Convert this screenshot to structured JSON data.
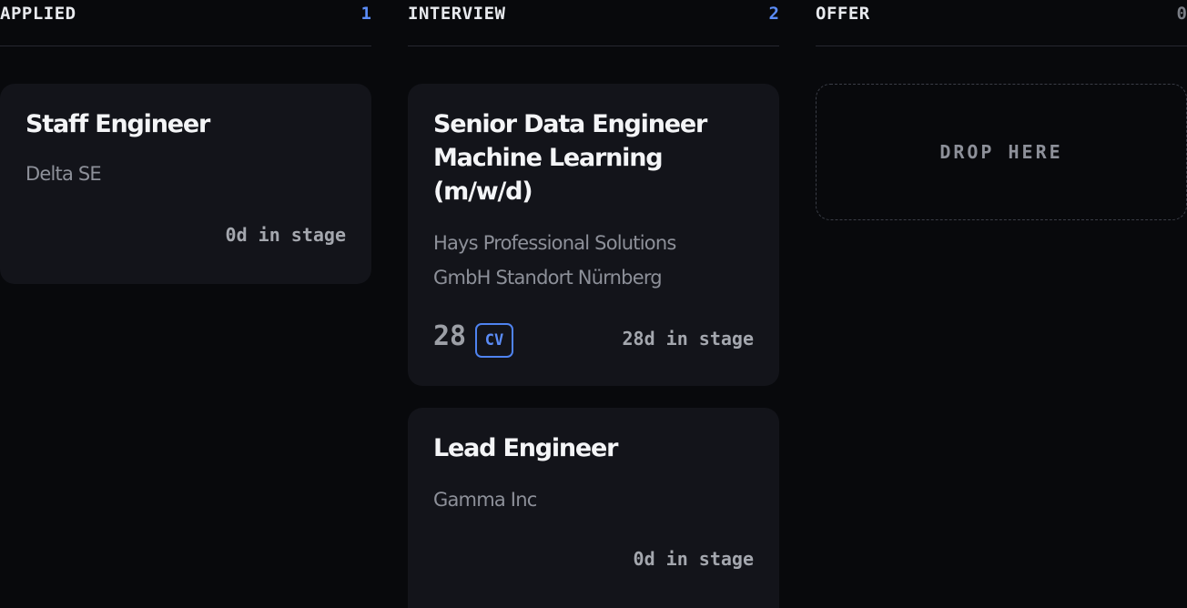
{
  "columns": [
    {
      "title": "APPLIED",
      "count": "1",
      "cards": [
        {
          "title": "Staff Engineer",
          "company": "Delta SE",
          "stage": "0d in stage"
        }
      ]
    },
    {
      "title": "INTERVIEW",
      "count": "2",
      "cards": [
        {
          "title_lines": [
            "Senior Data Engineer",
            "Machine Learning",
            "(m/w/d)"
          ],
          "company_lines": [
            "Hays Professional Solutions",
            "GmbH Standort Nürnberg"
          ],
          "score": "28",
          "tag": "CV",
          "stage": "28d in stage"
        },
        {
          "title": "Lead Engineer",
          "company": "Gamma Inc",
          "stage": "0d in stage"
        }
      ]
    },
    {
      "title": "OFFER",
      "count": "0",
      "drop_label": "DROP HERE"
    }
  ],
  "colors": {
    "background": "#08090c",
    "card": "#13141a",
    "accent": "#5b8cf7",
    "muted_text": "#8d9099"
  }
}
